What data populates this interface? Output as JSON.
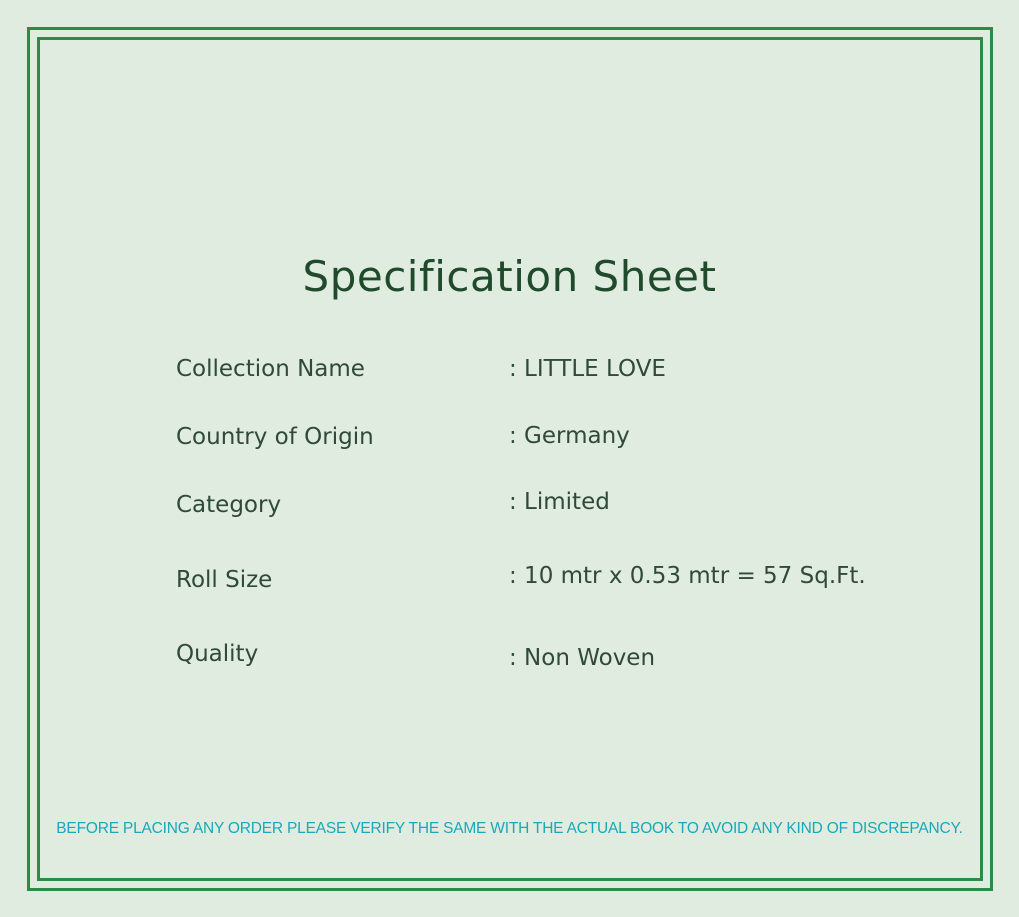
{
  "title": "Specification Sheet",
  "specs": [
    {
      "label": "Collection Name",
      "value": ": LITTLE LOVE"
    },
    {
      "label": "Country of Origin",
      "value": ": Germany"
    },
    {
      "label": "Category",
      "value": ": Limited"
    },
    {
      "label": "Roll Size",
      "value": ": 10 mtr x 0.53 mtr = 57 Sq.Ft."
    },
    {
      "label": "Quality",
      "value": ": Non Woven"
    }
  ],
  "disclaimer": "BEFORE PLACING ANY ORDER PLEASE VERIFY THE SAME WITH THE ACTUAL BOOK TO AVOID ANY KIND OF DISCREPANCY.",
  "colors": {
    "background": "#e0ece0",
    "border": "#2e8b45",
    "text": "#2f4a36",
    "title": "#1f4a2b",
    "disclaimer": "#1aa8b8"
  }
}
